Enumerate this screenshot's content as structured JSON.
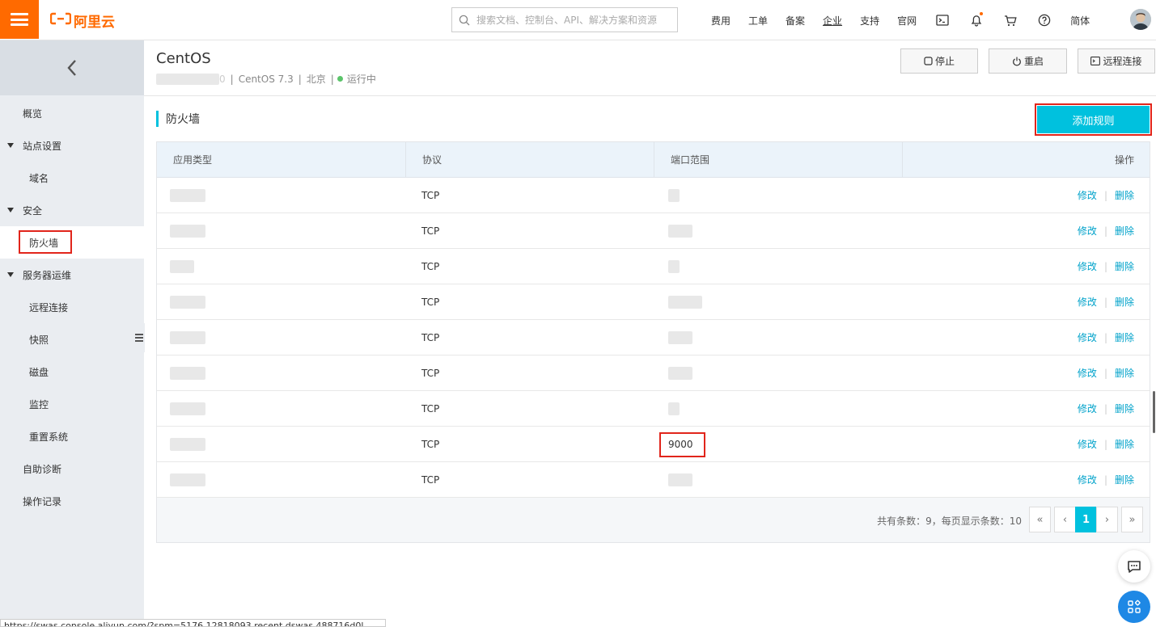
{
  "topbar": {
    "logo_text": "阿里云",
    "search_placeholder": "搜索文档、控制台、API、解决方案和资源",
    "nav_links": [
      "费用",
      "工单",
      "备案",
      "企业",
      "支持",
      "官网"
    ],
    "lang": "简体"
  },
  "sidebar": {
    "items": [
      {
        "label": "概览"
      },
      {
        "label": "站点设置"
      },
      {
        "label": "域名"
      },
      {
        "label": "安全"
      },
      {
        "label": "防火墙"
      },
      {
        "label": "服务器运维"
      },
      {
        "label": "远程连接"
      },
      {
        "label": "快照"
      },
      {
        "label": "磁盘"
      },
      {
        "label": "监控"
      },
      {
        "label": "重置系统"
      },
      {
        "label": "自助诊断"
      },
      {
        "label": "操作记录"
      }
    ]
  },
  "header": {
    "title": "CentOS",
    "sub_id_suffix": "0",
    "sub_sep": "|",
    "os": "CentOS 7.3",
    "region": "北京",
    "status": "运行中",
    "status_color": "#5bc46a",
    "stop_label": "停止",
    "restart_label": "重启",
    "remote_label": "远程连接"
  },
  "section": {
    "title": "防火墙",
    "add_rule_label": "添加规则",
    "accent": "#00c1de"
  },
  "table": {
    "columns": [
      "应用类型",
      "协议",
      "端口范围",
      "操作"
    ],
    "rows": [
      {
        "protocol": "TCP",
        "port": ""
      },
      {
        "protocol": "TCP",
        "port": ""
      },
      {
        "protocol": "TCP",
        "port": ""
      },
      {
        "protocol": "TCP",
        "port": ""
      },
      {
        "protocol": "TCP",
        "port": ""
      },
      {
        "protocol": "TCP",
        "port": ""
      },
      {
        "protocol": "TCP",
        "port": ""
      },
      {
        "protocol": "TCP",
        "port": "9000"
      },
      {
        "protocol": "TCP",
        "port": ""
      }
    ],
    "edit_label": "修改",
    "delete_label": "删除",
    "op_sep": "|",
    "footer_info": "共有条数：9，每页显示条数：10",
    "pager": {
      "first": "«",
      "prev": "‹",
      "current": "1",
      "next": "›",
      "last": "»"
    }
  },
  "statusbar": {
    "url": "https://swas.console.aliyun.com/?spm=5176.12818093.recent.dswas.488716d0l..."
  },
  "icons": {
    "menu": "menu-icon",
    "search": "search-icon",
    "terminal": "terminal-icon",
    "bell": "bell-icon",
    "cart": "cart-icon",
    "help": "help-icon",
    "chat": "chat-icon",
    "apps": "apps-icon"
  }
}
